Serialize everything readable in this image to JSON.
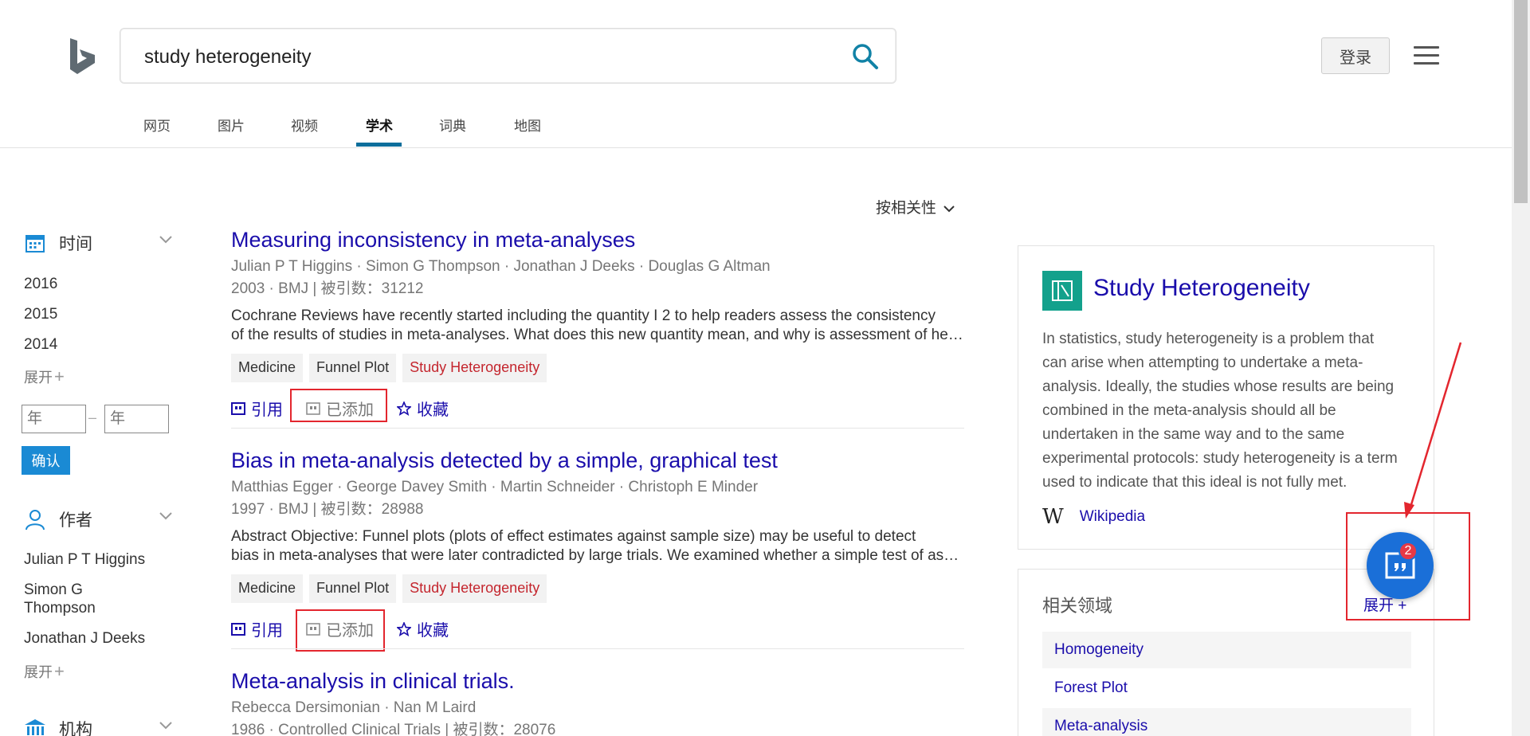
{
  "search": {
    "query": "study heterogeneity"
  },
  "header": {
    "login_label": "登录"
  },
  "tabs": [
    {
      "label": "网页"
    },
    {
      "label": "图片"
    },
    {
      "label": "视频"
    },
    {
      "label": "学术",
      "active": true
    },
    {
      "label": "词典"
    },
    {
      "label": "地图"
    }
  ],
  "filters": {
    "time": {
      "label": "时间",
      "items": [
        "2016",
        "2015",
        "2014"
      ],
      "expand": "展开",
      "year_placeholder": "年",
      "confirm": "确认"
    },
    "author": {
      "label": "作者",
      "items": [
        "Julian P T Higgins",
        "Simon G Thompson",
        "Jonathan J Deeks"
      ],
      "expand": "展开"
    },
    "institution": {
      "label": "机构"
    }
  },
  "sort_label": "按相关性",
  "results": [
    {
      "title": "Measuring inconsistency in meta-analyses",
      "authors": "Julian P T Higgins · Simon G Thompson · Jonathan J Deeks · Douglas G Altman",
      "meta": "2003 · BMJ  |  被引数：31212",
      "abstract_line1": "Cochrane Reviews have recently started including the quantity I 2 to help readers assess the consistency",
      "abstract_line2": "of the results of studies in meta-analyses. What does this new quantity mean, and why is assessment of heterogeneity so important",
      "tags": [
        "Medicine",
        "Funnel Plot",
        "Study Heterogeneity"
      ],
      "cite": "引用",
      "added": "已添加",
      "save": "收藏"
    },
    {
      "title": "Bias in meta-analysis detected by a simple, graphical test",
      "authors": "Matthias Egger · George Davey Smith · Martin Schneider · Christoph E Minder",
      "meta": "1997 · BMJ  |  被引数：28988",
      "abstract_line1": "Abstract Objective: Funnel plots (plots of effect estimates against sample size) may be useful to detect",
      "abstract_line2": "bias in meta-analyses that were later contradicted by large trials. We examined whether a simple test of asymmetry",
      "tags": [
        "Medicine",
        "Funnel Plot",
        "Study Heterogeneity"
      ],
      "cite": "引用",
      "added": "已添加",
      "save": "收藏"
    },
    {
      "title": "Meta-analysis in clinical trials.",
      "authors": "Rebecca Dersimonian · Nan M Laird",
      "meta": "1986 · Controlled Clinical Trials  |  被引数：28076"
    }
  ],
  "knowledge": {
    "title": "Study Heterogeneity",
    "desc_lines": [
      "In statistics, study heterogeneity is a problem that",
      "can arise when attempting to undertake a meta-",
      "analysis. Ideally, the studies whose results are being",
      "combined in the meta-analysis should all be",
      "undertaken in the same way and to the same",
      "experimental protocols: study heterogeneity is a term",
      "used to indicate that this ideal is not fully met."
    ],
    "source": "Wikipedia"
  },
  "related": {
    "title": "相关领域",
    "expand": "展开",
    "items": [
      "Homogeneity",
      "Forest Plot",
      "Meta-analysis"
    ]
  },
  "fab": {
    "badge": "2"
  },
  "colors": {
    "link": "#1a0dab",
    "accent": "#1a6fd8",
    "annotation": "#e3262e",
    "tag_red": "#c4262e"
  }
}
